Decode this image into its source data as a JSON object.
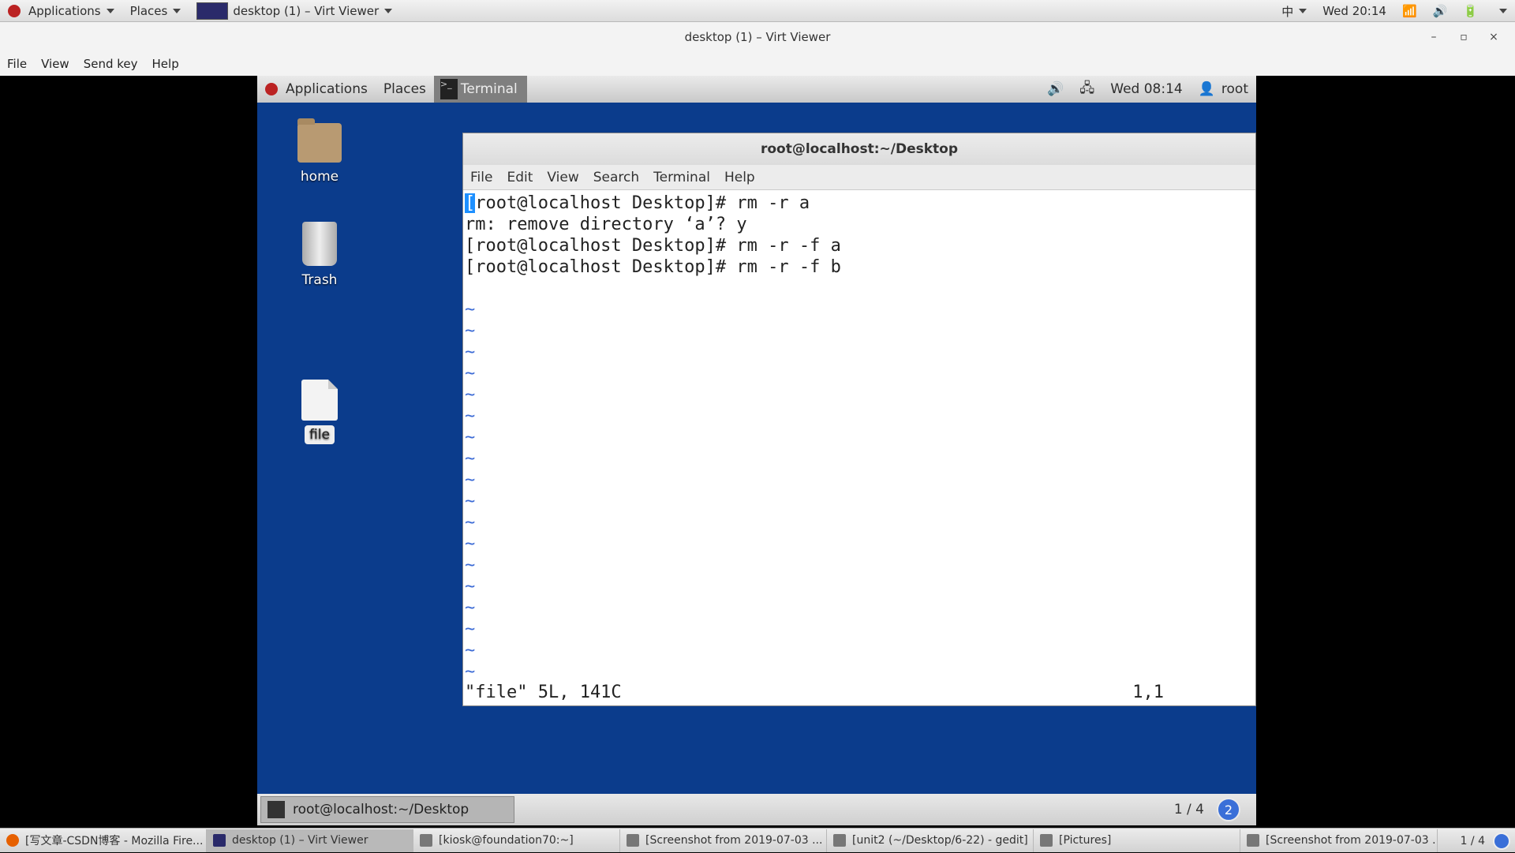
{
  "host_panel": {
    "applications": "Applications",
    "places": "Places",
    "window_title": "desktop (1) – Virt Viewer",
    "input_method": "中",
    "clock": "Wed 20:14"
  },
  "virt_viewer": {
    "title": "desktop (1) – Virt Viewer",
    "menu": [
      "File",
      "View",
      "Send key",
      "Help"
    ],
    "controls": [
      "–",
      "▫",
      "×"
    ]
  },
  "guest": {
    "panel": {
      "applications": "Applications",
      "places": "Places",
      "terminal": "Terminal",
      "clock": "Wed 08:14",
      "user": "root"
    },
    "desktop_icons": [
      {
        "label": "home"
      },
      {
        "label": "Trash"
      },
      {
        "label": "file"
      }
    ],
    "terminal": {
      "title": "root@localhost:~/Desktop",
      "menu": [
        "File",
        "Edit",
        "View",
        "Search",
        "Terminal",
        "Help"
      ],
      "lines": [
        "[root@localhost Desktop]# rm -r a",
        "rm: remove directory ‘a’? y",
        "[root@localhost Desktop]# rm -r -f a",
        "[root@localhost Desktop]# rm -r -f b",
        ""
      ],
      "tilde_count": 18,
      "tilde": "~",
      "status_left": "\"file\" 5L, 141C",
      "status_pos": "1,1"
    },
    "bottom": {
      "task": "root@localhost:~/Desktop",
      "workspace": "1 / 4",
      "notifications": "2"
    }
  },
  "host_taskbar": {
    "tasks": [
      {
        "label": "[写文章-CSDN博客 - Mozilla Fire...",
        "icon": "firefox-icon",
        "active": false
      },
      {
        "label": "desktop (1) – Virt Viewer",
        "icon": "virt-viewer-icon",
        "active": true
      },
      {
        "label": "[kiosk@foundation70:~]",
        "icon": "terminal-icon",
        "active": false
      },
      {
        "label": "[Screenshot from 2019-07-03 ...",
        "icon": "screenshot-icon",
        "active": false
      },
      {
        "label": "[unit2 (~/Desktop/6-22) - gedit]",
        "icon": "gedit-icon",
        "active": false
      },
      {
        "label": "[Pictures]",
        "icon": "folder-icon",
        "active": false
      },
      {
        "label": "[Screenshot from 2019-07-03 ...",
        "icon": "screenshot-icon",
        "active": false
      }
    ],
    "workspace": "1 / 4"
  },
  "colors": {
    "guest_desktop": "#0b3c8c",
    "cursor": "#1e90ff",
    "tilde": "#3c6bd6"
  }
}
